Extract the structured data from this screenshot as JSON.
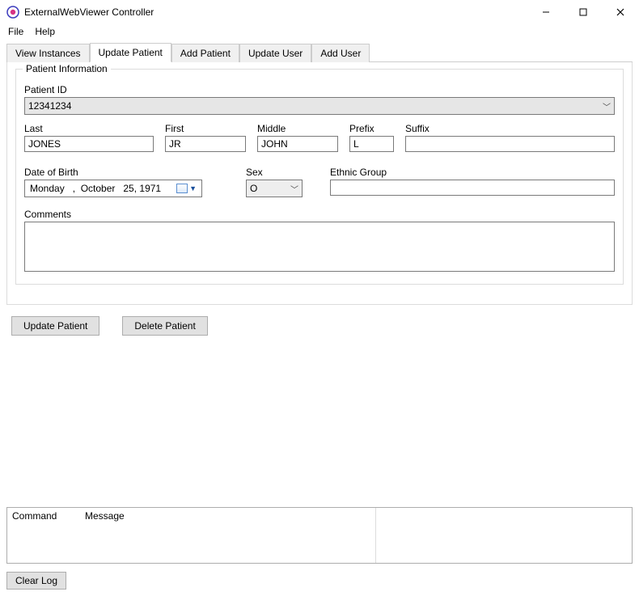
{
  "window": {
    "title": "ExternalWebViewer Controller"
  },
  "menu": {
    "file": "File",
    "help": "Help"
  },
  "tabs": {
    "view_instances": "View Instances",
    "update_patient": "Update Patient",
    "add_patient": "Add Patient",
    "update_user": "Update User",
    "add_user": "Add User"
  },
  "group": {
    "title": "Patient Information"
  },
  "labels": {
    "patient_id": "Patient ID",
    "last": "Last",
    "first": "First",
    "middle": "Middle",
    "prefix": "Prefix",
    "suffix": "Suffix",
    "dob": "Date of Birth",
    "sex": "Sex",
    "ethnic": "Ethnic Group",
    "comments": "Comments"
  },
  "values": {
    "patient_id": "12341234",
    "last": "JONES",
    "first": "JR",
    "middle": "JOHN",
    "prefix": "L",
    "suffix": "",
    "dob": "Monday   ,  October   25, 1971",
    "sex": "O",
    "ethnic": "",
    "comments": ""
  },
  "buttons": {
    "update_patient": "Update Patient",
    "delete_patient": "Delete Patient",
    "clear_log": "Clear Log"
  },
  "log": {
    "col_command": "Command",
    "col_message": "Message"
  }
}
